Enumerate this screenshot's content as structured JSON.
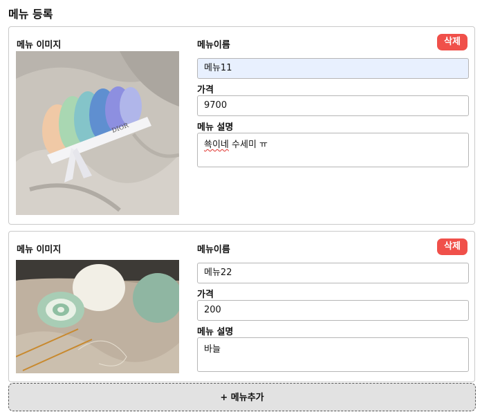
{
  "page": {
    "title": "메뉴 등록"
  },
  "labels": {
    "image": "메뉴 이미지",
    "name": "메뉴이름",
    "price": "가격",
    "description": "메뉴 설명",
    "delete": "삭제"
  },
  "menus": [
    {
      "name": "메뉴11",
      "price": "9700",
      "description_misspelled": "쑉이네",
      "description_rest": " 수세미 ㅠ",
      "image_icon": "photo-yarn-scrunchies-icon"
    },
    {
      "name": "메뉴22",
      "price": "200",
      "description": "바늘",
      "image_icon": "photo-yarn-balls-icon"
    }
  ],
  "add_button": {
    "label": "+ 메뉴추가"
  },
  "colors": {
    "delete": "#f0504a",
    "autofill": "#e8f0fe",
    "add_bg": "#e2e2e2"
  }
}
